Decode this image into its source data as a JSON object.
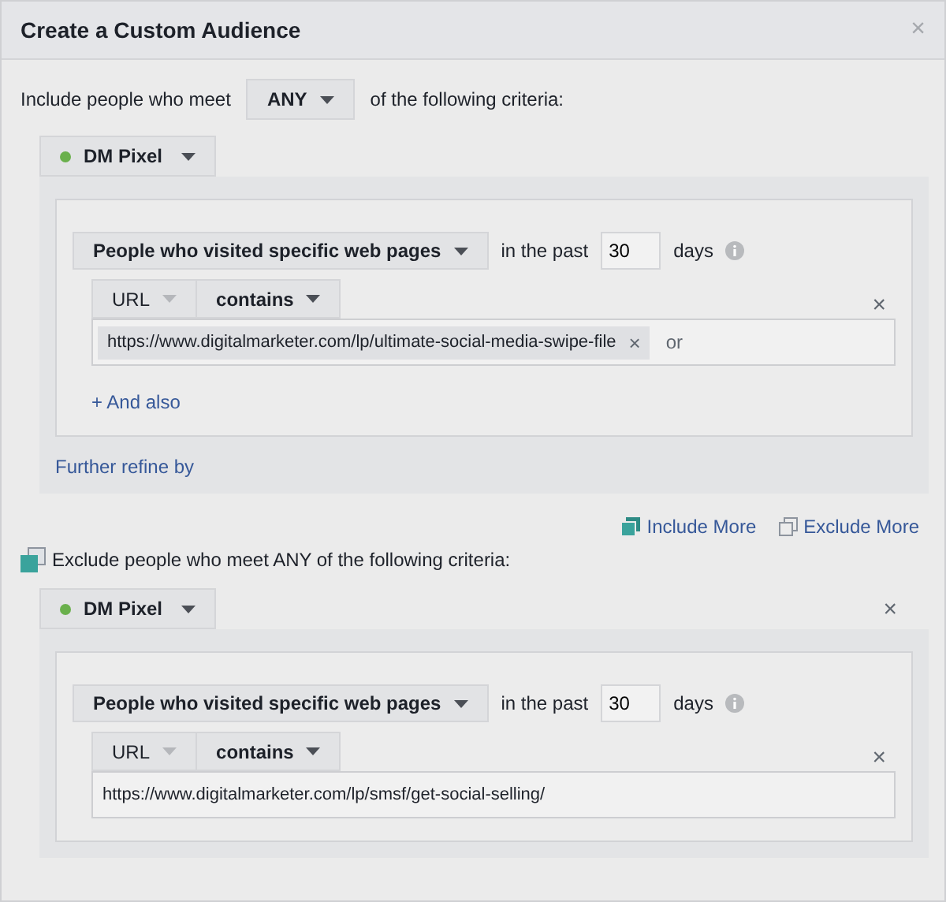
{
  "dialog": {
    "title": "Create a Custom Audience",
    "close": "×"
  },
  "include": {
    "prefix": "Include people who meet",
    "match": "ANY",
    "suffix": "of the following criteria:",
    "pixel": {
      "name": "DM Pixel",
      "color": "#6ab04c"
    },
    "rule": {
      "event": "People who visited specific web pages",
      "past_label": "in the past",
      "days": "30",
      "days_label": "days",
      "field": "URL",
      "operator": "contains",
      "remove": "×",
      "urls": [
        {
          "kind": "token",
          "value": "https://www.digitalmarketer.com/lp/ultimate-social-media-swipe-file",
          "remove": "×"
        }
      ],
      "or": "or"
    },
    "and_also": "+ And also",
    "refine": "Further refine by"
  },
  "actions": [
    {
      "kind": "include",
      "label": "Include More"
    },
    {
      "kind": "exclude",
      "label": "Exclude More"
    }
  ],
  "exclude": {
    "text": "Exclude people who meet ANY of the following criteria:",
    "remove": "×",
    "pixel": {
      "name": "DM Pixel",
      "color": "#6ab04c"
    },
    "rule": {
      "event": "People who visited specific web pages",
      "past_label": "in the past",
      "days": "30",
      "days_label": "days",
      "field": "URL",
      "operator": "contains",
      "remove": "×",
      "urls": [
        {
          "kind": "text",
          "value": "https://www.digitalmarketer.com/lp/smsf/get-social-selling/"
        }
      ]
    }
  }
}
